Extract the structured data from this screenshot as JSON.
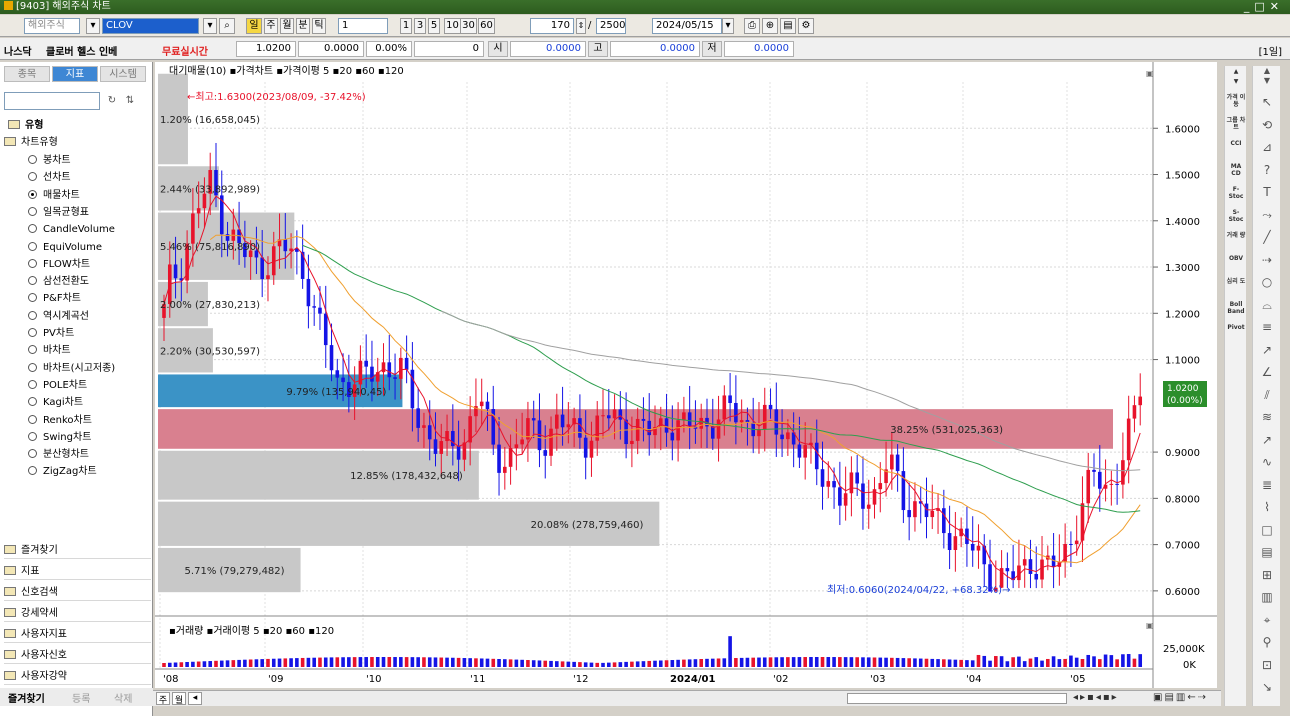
{
  "window": {
    "title": "[9403] 해외주식 차트"
  },
  "toolbar": {
    "market": "해외주식",
    "symbol": "CLOV",
    "periods": [
      "주",
      "월",
      "분",
      "틱"
    ],
    "interval": "1",
    "quick_ticks": [
      "1",
      "3",
      "5",
      "10",
      "30",
      "60"
    ],
    "count": "170",
    "total": "2500",
    "date": "2024/05/15"
  },
  "quote": {
    "name": "나스닥",
    "company": "클로버 헬스 인베",
    "realtime_label": "무료실시간",
    "price": "1.0200",
    "change": "0.0000",
    "change_pct": "0.00%",
    "volume": "0",
    "open_label": "시",
    "open": "0.0000",
    "high_label": "고",
    "high": "0.0000",
    "low_label": "저",
    "low": "0.0000",
    "period_badge": "[1일]"
  },
  "sidebar": {
    "tabs": [
      "종목",
      "지표",
      "시스템"
    ],
    "active_tab": "지표",
    "root": "유형",
    "group": "차트유형",
    "items": [
      {
        "label": "봉차트",
        "selected": false
      },
      {
        "label": "선차트",
        "selected": false
      },
      {
        "label": "매물차트",
        "selected": true
      },
      {
        "label": "일목균형표",
        "selected": false
      },
      {
        "label": "CandleVolume",
        "selected": false
      },
      {
        "label": "EquiVolume",
        "selected": false
      },
      {
        "label": "FLOW차트",
        "selected": false
      },
      {
        "label": "삼선전환도",
        "selected": false
      },
      {
        "label": "P&F차트",
        "selected": false
      },
      {
        "label": "역시계곡선",
        "selected": false
      },
      {
        "label": "PV차트",
        "selected": false
      },
      {
        "label": "바차트",
        "selected": false
      },
      {
        "label": "바차트(시고저종)",
        "selected": false
      },
      {
        "label": "POLE차트",
        "selected": false
      },
      {
        "label": "Kagi차트",
        "selected": false
      },
      {
        "label": "Renko차트",
        "selected": false
      },
      {
        "label": "Swing차트",
        "selected": false
      },
      {
        "label": "분산형차트",
        "selected": false
      },
      {
        "label": "ZigZag차트",
        "selected": false
      }
    ],
    "sections": [
      "즐겨찾기",
      "지표",
      "신호검색",
      "강세약세",
      "사용자지표",
      "사용자신호",
      "사용자강약"
    ],
    "bottom_tabs": [
      "즐겨찾기",
      "등록",
      "삭제"
    ]
  },
  "chart": {
    "legend": "대기매물(10) ▪가격차트 ▪가격이평 5 ▪20 ▪60 ▪120",
    "high_note": "←최고:1.6300(2023/08/09, -37.42%)",
    "low_note": "최저:0.6060(2024/04/22, +68.32%)→",
    "current_value": "1.0200",
    "current_pct": "(0.00%)",
    "y_ticks": [
      "1.6000",
      "1.5000",
      "1.4000",
      "1.3000",
      "1.2000",
      "1.1000",
      "0.9000",
      "0.8000",
      "0.7000",
      "0.6000"
    ],
    "volume_legend": "▪거래량 ▪거래이평 5 ▪20 ▪60 ▪120",
    "vol_ticks": [
      "25,000K",
      "0K"
    ],
    "x_labels": [
      "'08",
      "'09",
      "'10",
      "'11",
      "'12",
      "2024/01",
      "'02",
      "'03",
      "'04",
      "'05"
    ],
    "profile": [
      {
        "label": "1.20% (16,658,045)"
      },
      {
        "label": "2.44% (33,892,989)"
      },
      {
        "label": "5.46% (75,816,890)"
      },
      {
        "label": "2.00% (27,830,213)"
      },
      {
        "label": "2.20% (30,530,597)"
      },
      {
        "label": "9.79% (135,940,45)"
      },
      {
        "label": "38.25% (531,025,363)"
      },
      {
        "label": "12.85% (178,432,648)"
      },
      {
        "label": "20.08% (278,759,460)"
      },
      {
        "label": "5.71% (79,279,482)"
      }
    ]
  },
  "chart_data": {
    "type": "candlestick",
    "profile_pcts": [
      1.2,
      2.44,
      5.46,
      2.0,
      2.2,
      9.79,
      38.25,
      12.85,
      20.08,
      5.71
    ],
    "profile_volumes": [
      16658045,
      33892989,
      75816890,
      27830213,
      30530597,
      135940450,
      531025363,
      178432648,
      278759460,
      79279482
    ],
    "ylim": [
      0.55,
      1.7
    ],
    "close_path": [
      1.25,
      1.3,
      1.42,
      1.48,
      1.38,
      1.33,
      1.3,
      1.33,
      1.34,
      1.28,
      1.15,
      1.05,
      1.06,
      1.06,
      1.09,
      1.08,
      0.98,
      0.93,
      0.9,
      0.92,
      1.04,
      0.88,
      0.9,
      0.95,
      0.92,
      0.97,
      0.94,
      0.93,
      0.98,
      0.96,
      0.95,
      0.94,
      0.97,
      0.95,
      0.96,
      0.97,
      0.99,
      0.96,
      0.97,
      0.95,
      0.93,
      0.88,
      0.85,
      0.8,
      0.82,
      0.8,
      0.88,
      0.8,
      0.78,
      0.75,
      0.73,
      0.7,
      0.66,
      0.62,
      0.63,
      0.67,
      0.64,
      0.67,
      0.75,
      0.85,
      0.82,
      0.9,
      1.02
    ],
    "current": 1.02,
    "high": 1.63,
    "low": 0.606
  },
  "colors": {
    "accent": "#3e87d4",
    "profile_blue": "#3b93c6",
    "profile_red": "#d9808f",
    "profile_gray": "#c8c8c8",
    "up": "#e8132b",
    "down": "#1414e6"
  }
}
